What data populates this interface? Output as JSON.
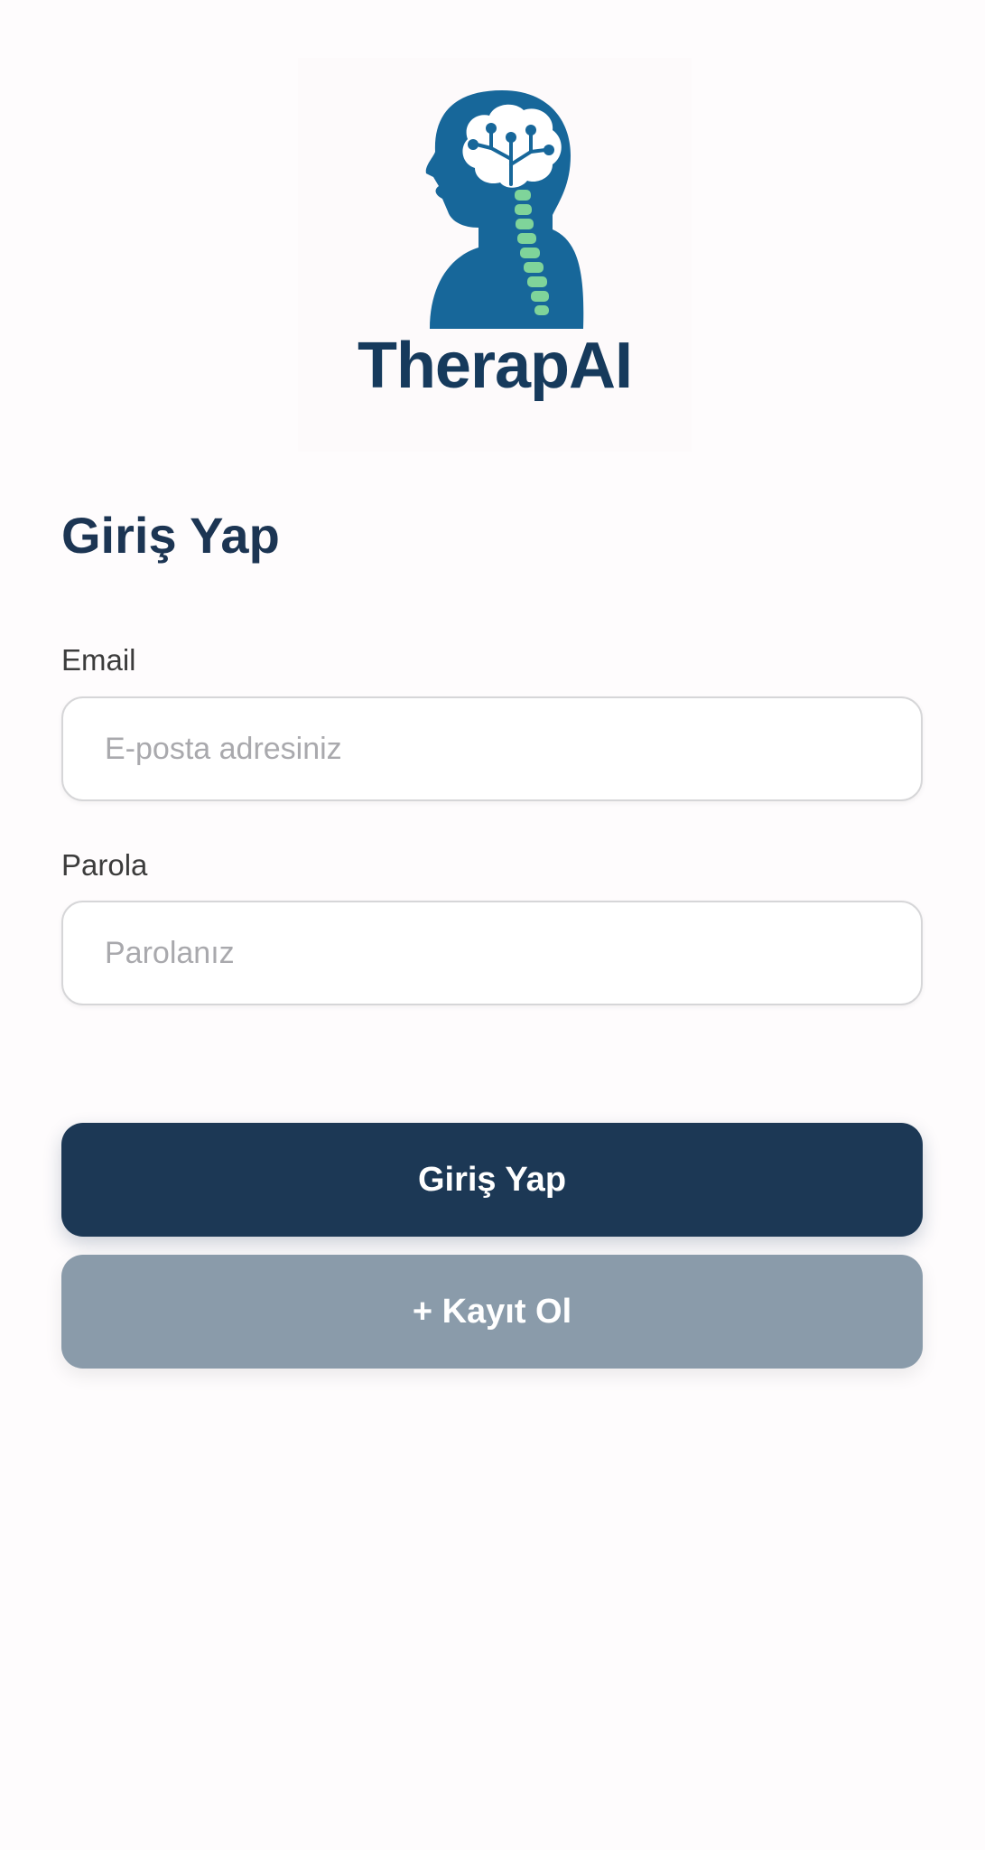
{
  "logo": {
    "brand_text": "TherapAI",
    "icon": "head-brain-spine-icon",
    "colors": {
      "head": "#17679a",
      "spine": "#7fd49a",
      "brand_text": "#163a5c"
    }
  },
  "login": {
    "title": "Giriş Yap",
    "email_label": "Email",
    "email_placeholder": "E-posta adresiniz",
    "password_label": "Parola",
    "password_placeholder": "Parolanız",
    "login_button": "Giriş Yap",
    "register_button": "+ Kayıt Ol"
  },
  "colors": {
    "primary": "#1c3855",
    "secondary": "#8a9baa",
    "title": "#1c3553"
  }
}
